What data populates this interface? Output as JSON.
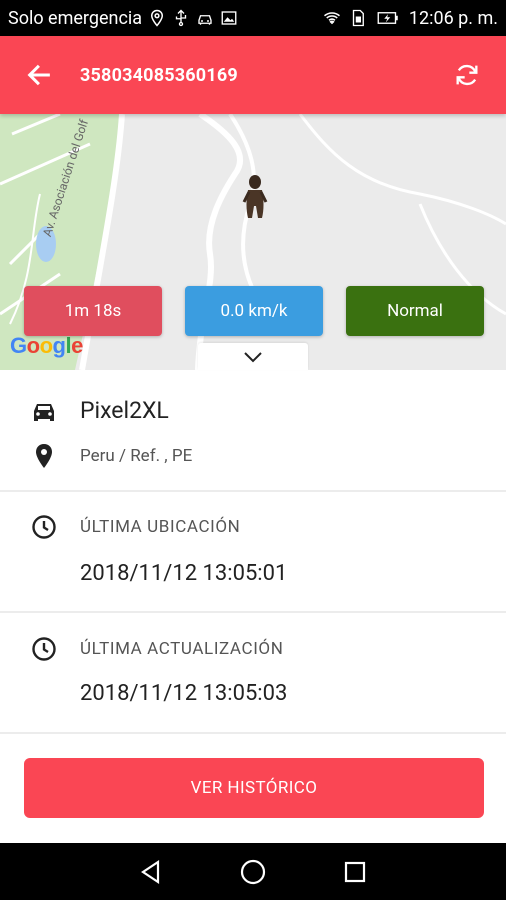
{
  "status_bar": {
    "carrier": "Solo emergencia",
    "time": "12:06 p. m."
  },
  "app_bar": {
    "title": "358034085360169",
    "back_icon": "arrow-back-icon",
    "refresh_icon": "refresh-icon"
  },
  "map": {
    "road_label": "Av. Asociación del Golf",
    "google_logo": "Google",
    "pills": {
      "time": "1m 18s",
      "speed": "0.0 km/k",
      "state": "Normal"
    }
  },
  "device": {
    "name": "Pixel2XL",
    "location": "Peru  / Ref. , PE"
  },
  "last_location": {
    "label": "ÚLTIMA UBICACIÓN",
    "value": "2018/11/12 13:05:01"
  },
  "last_update": {
    "label": "ÚLTIMA ACTUALIZACIÓN",
    "value": "2018/11/12 13:05:03"
  },
  "history_button": "VER HISTÓRICO",
  "colors": {
    "primary": "#fa4654",
    "time_pill": "#e04e5e",
    "speed_pill": "#3b9de0",
    "state_pill": "#3a7110"
  }
}
